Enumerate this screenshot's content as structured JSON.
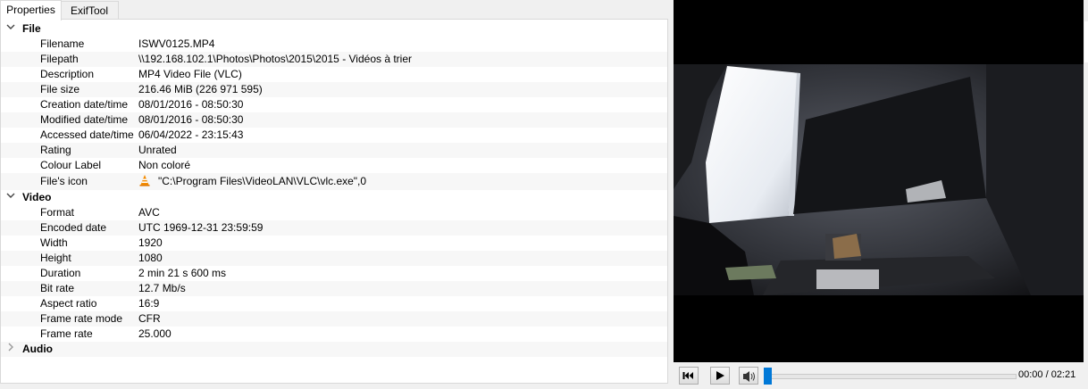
{
  "tabs": [
    {
      "label": "Properties"
    },
    {
      "label": "ExifTool"
    }
  ],
  "groups": {
    "file": {
      "label": "File",
      "rows": [
        {
          "key": "Filename",
          "value": "ISWV0125.MP4"
        },
        {
          "key": "Filepath",
          "value": "\\\\192.168.102.1\\Photos\\Photos\\2015\\2015 - Vidéos à trier"
        },
        {
          "key": "Description",
          "value": "MP4 Video File (VLC)"
        },
        {
          "key": "File size",
          "value": "216.46 MiB (226 971 595)"
        },
        {
          "key": "Creation date/time",
          "value": "08/01/2016 - 08:50:30"
        },
        {
          "key": "Modified date/time",
          "value": "08/01/2016 - 08:50:30"
        },
        {
          "key": "Accessed date/time",
          "value": "06/04/2022 - 23:15:43"
        },
        {
          "key": "Rating",
          "value": "Unrated"
        },
        {
          "key": "Colour Label",
          "value": "Non coloré"
        },
        {
          "key": "File's icon",
          "value": "\"C:\\Program Files\\VideoLAN\\VLC\\vlc.exe\",0",
          "icon": "vlc-cone-icon"
        }
      ]
    },
    "video": {
      "label": "Video",
      "rows": [
        {
          "key": "Format",
          "value": "AVC"
        },
        {
          "key": "Encoded date",
          "value": "UTC 1969-12-31 23:59:59"
        },
        {
          "key": "Width",
          "value": "1920"
        },
        {
          "key": "Height",
          "value": "1080"
        },
        {
          "key": "Duration",
          "value": "2 min 21 s 600 ms"
        },
        {
          "key": "Bit rate",
          "value": "12.7 Mb/s"
        },
        {
          "key": "Aspect ratio",
          "value": "16:9"
        },
        {
          "key": "Frame rate mode",
          "value": "CFR"
        },
        {
          "key": "Frame rate",
          "value": "25.000"
        }
      ]
    },
    "audio": {
      "label": "Audio",
      "rows": []
    }
  },
  "player": {
    "time": "00:00 / 02:21",
    "progress_fraction": 0.0,
    "controls": [
      "skip-back-icon",
      "play-icon",
      "volume-icon"
    ]
  },
  "colors": {
    "accent": "#0078d7",
    "tree_bg": "#ffffff",
    "panel_bg": "#f0f0f0",
    "video_bg": "#000000"
  }
}
